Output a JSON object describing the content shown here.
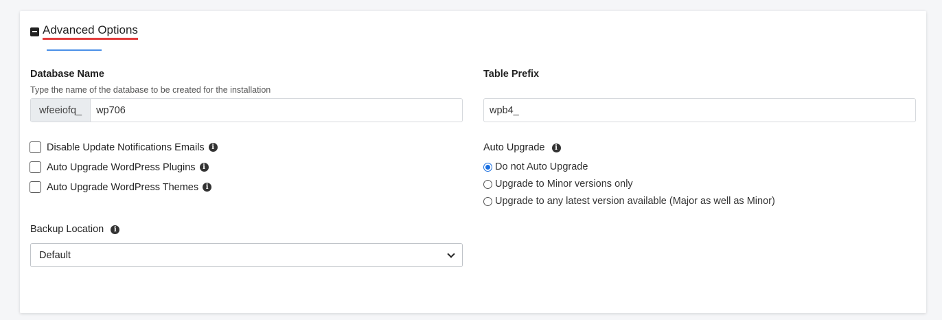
{
  "section": {
    "title": "Advanced Options",
    "icon": "minus-square-icon"
  },
  "database": {
    "label": "Database Name",
    "hint": "Type the name of the database to be created for the installation",
    "prefix": "wfeeiofq_",
    "value": "wp706"
  },
  "table_prefix": {
    "label": "Table Prefix",
    "value": "wpb4_"
  },
  "checkboxes": [
    {
      "label": "Disable Update Notifications Emails",
      "checked": false
    },
    {
      "label": "Auto Upgrade WordPress Plugins",
      "checked": false
    },
    {
      "label": "Auto Upgrade WordPress Themes",
      "checked": false
    }
  ],
  "auto_upgrade": {
    "label": "Auto Upgrade",
    "options": [
      {
        "label": "Do not Auto Upgrade",
        "selected": true
      },
      {
        "label": "Upgrade to Minor versions only",
        "selected": false
      },
      {
        "label": "Upgrade to any latest version available (Major as well as Minor)",
        "selected": false
      }
    ]
  },
  "backup": {
    "label": "Backup Location",
    "selected": "Default"
  },
  "info_glyph": "i",
  "colors": {
    "accent_red": "#e23b3b",
    "accent_blue": "#4a8fe7",
    "radio_blue": "#1a6fe0"
  }
}
